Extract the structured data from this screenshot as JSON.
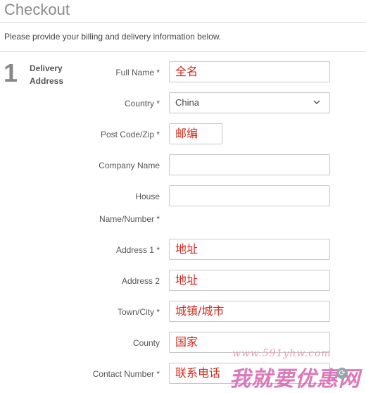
{
  "page": {
    "title": "Checkout",
    "intro": "Please provide your billing and delivery information below."
  },
  "step": {
    "number": "1",
    "label": "Delivery Address"
  },
  "form": {
    "full_name": {
      "label": "Full Name *",
      "value": "全名"
    },
    "country": {
      "label": "Country *",
      "value": "China",
      "icon": "chevron-down-icon"
    },
    "post_code": {
      "label": "Post Code/Zip *",
      "value": "邮编"
    },
    "company": {
      "label": "Company Name",
      "value": ""
    },
    "house": {
      "label_line1": "House",
      "label_line2": "Name/Number *"
    },
    "address1": {
      "label": "Address 1 *",
      "value": "地址"
    },
    "address2": {
      "label": "Address 2",
      "value": "地址"
    },
    "town": {
      "label": "Town/City *",
      "value": "城镇/城市"
    },
    "county": {
      "label": "County",
      "value": "国家"
    },
    "contact": {
      "label": "Contact Number *",
      "value": "联系电话"
    }
  },
  "watermark": {
    "url": "www.591yhw.com",
    "text": "我就要优惠网"
  },
  "colors": {
    "annotation": "#d22a1e",
    "watermark": "#d660b0"
  }
}
